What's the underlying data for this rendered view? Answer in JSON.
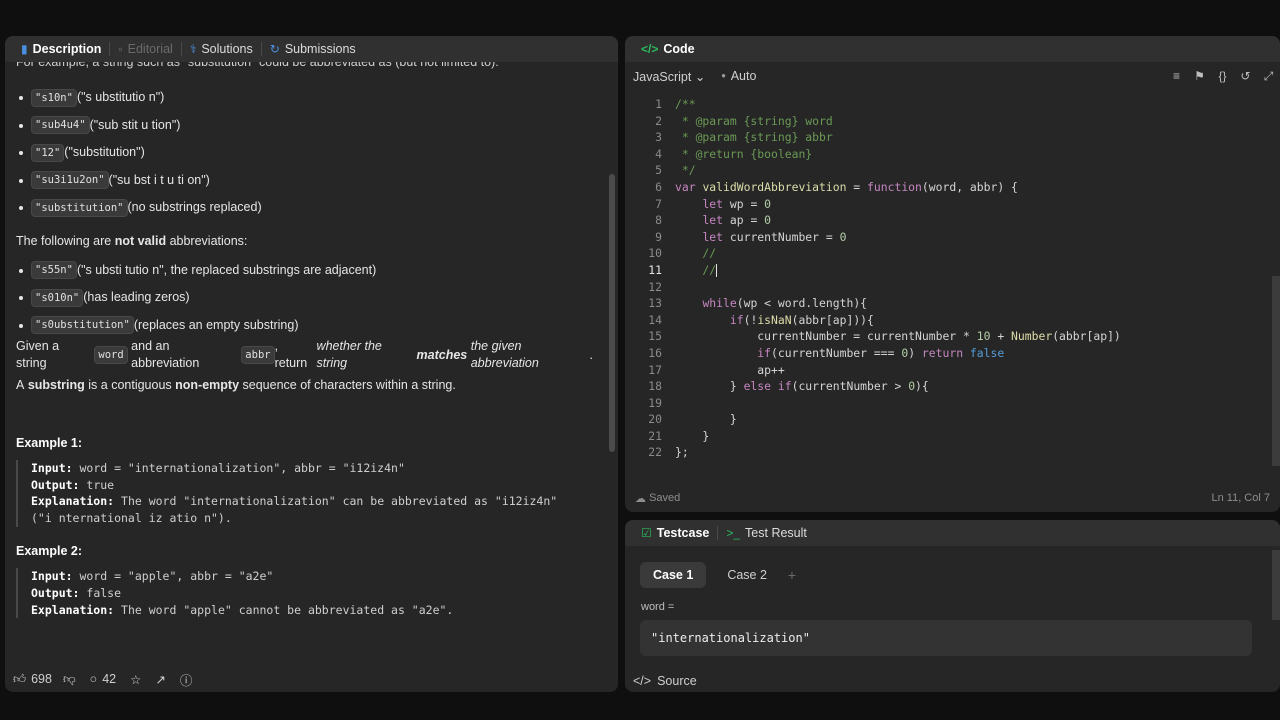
{
  "left": {
    "tabs": [
      {
        "label": "Description",
        "icon": "document-icon"
      },
      {
        "label": "Editorial",
        "icon": "book-icon"
      },
      {
        "label": "Solutions",
        "icon": "flask-icon"
      },
      {
        "label": "Submissions",
        "icon": "history-icon"
      }
    ],
    "clipped_line": "For example, a string such as \"substitution\" could be abbreviated as (but not limited to):",
    "bullets": [
      {
        "code": "\"s10n\"",
        "rest": " (\"s ubstitutio n\")"
      },
      {
        "code": "\"sub4u4\"",
        "rest": " (\"sub stit u tion\")"
      },
      {
        "code": "\"12\"",
        "rest": " (\"substitution\")"
      },
      {
        "code": "\"su3i1u2on\"",
        "rest": " (\"su bst i t u ti on\")"
      },
      {
        "code": "\"substitution\"",
        "rest": " (no substrings replaced)"
      }
    ],
    "not_valid_intro": {
      "pre": "The following are ",
      "bold": "not valid",
      "post": " abbreviations:"
    },
    "invalid_bullets": [
      {
        "code": "\"s55n\"",
        "rest": " (\"s ubsti tutio n\", the replaced substrings are adjacent)"
      },
      {
        "code": "\"s010n\"",
        "rest": " (has leading zeros)"
      },
      {
        "code": "\"s0ubstitution\"",
        "rest": " (replaces an empty substring)"
      }
    ],
    "given": {
      "p1": "Given a string ",
      "c1": "word",
      "p2": " and an abbreviation ",
      "c2": "abbr",
      "p3": ", return ",
      "i1": "whether the string ",
      "b1": "matches",
      "i2": " the given abbreviation",
      "p4": "."
    },
    "substring": {
      "p1": "A ",
      "b1": "substring",
      "p2": " is a contiguous ",
      "b2": "non-empty",
      "p3": " sequence of characters within a string."
    },
    "examples": [
      {
        "title": "Example 1:",
        "input_label": "Input:",
        "input": " word = \"internationalization\", abbr = \"i12iz4n\"",
        "output_label": "Output:",
        "output": " true",
        "expl_label": "Explanation:",
        "expl": " The word \"internationalization\" can be abbreviated as \"i12iz4n\"",
        "expl2": "(\"i nternational iz atio n\")."
      },
      {
        "title": "Example 2:",
        "input_label": "Input:",
        "input": " word = \"apple\", abbr = \"a2e\"",
        "output_label": "Output:",
        "output": " false",
        "expl_label": "Explanation:",
        "expl": " The word \"apple\" cannot be abbreviated as \"a2e\".",
        "expl2": ""
      }
    ],
    "footer": {
      "likes": "698",
      "comments": "42"
    }
  },
  "code": {
    "tab_label": "Code",
    "language": "JavaScript",
    "mode": "Auto",
    "status": "Saved",
    "position": "Ln 11, Col 7",
    "lines": [
      "/**",
      " * @param {string} word",
      " * @param {string} abbr",
      " * @return {boolean}",
      " */",
      "var validWordAbbreviation = function(word, abbr) {",
      "    let wp = 0",
      "    let ap = 0",
      "    let currentNumber = 0",
      "    //",
      "    //",
      "",
      "    while(wp < word.length){",
      "        if(!isNaN(abbr[ap])){",
      "            currentNumber = currentNumber * 10 + Number(abbr[ap])",
      "            if(currentNumber === 0) return false",
      "            ap++",
      "        } else if(currentNumber > 0){",
      "",
      "        }",
      "    }",
      "};"
    ]
  },
  "test": {
    "tabs": [
      {
        "label": "Testcase"
      },
      {
        "label": "Test Result"
      }
    ],
    "cases": [
      "Case 1",
      "Case 2"
    ],
    "var_label": "word =",
    "var_value": "\"internationalization\"",
    "source_label": "Source"
  }
}
